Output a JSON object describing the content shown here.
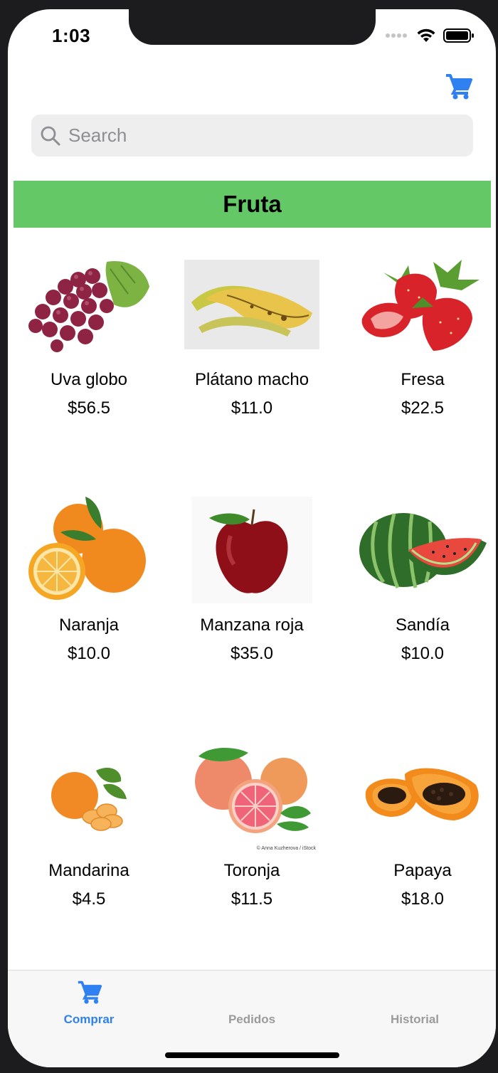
{
  "status_bar": {
    "time": "1:03"
  },
  "header": {
    "cart_icon": "cart-icon"
  },
  "search": {
    "placeholder": "Search",
    "value": ""
  },
  "category": {
    "title": "Fruta",
    "color": "#64c866"
  },
  "products": [
    {
      "name": "Uva globo",
      "price": "$56.5",
      "image": "grapes"
    },
    {
      "name": "Plátano macho",
      "price": "$11.0",
      "image": "plantain"
    },
    {
      "name": "Fresa",
      "price": "$22.5",
      "image": "strawberry"
    },
    {
      "name": "Naranja",
      "price": "$10.0",
      "image": "orange"
    },
    {
      "name": "Manzana roja",
      "price": "$35.0",
      "image": "apple"
    },
    {
      "name": "Sandía",
      "price": "$10.0",
      "image": "watermelon"
    },
    {
      "name": "Mandarina",
      "price": "$4.5",
      "image": "mandarin"
    },
    {
      "name": "Toronja",
      "price": "$11.5",
      "image": "grapefruit",
      "credit": "© Anna Kuzherova / iStock"
    },
    {
      "name": "Papaya",
      "price": "$18.0",
      "image": "papaya"
    }
  ],
  "tabs": [
    {
      "label": "Comprar",
      "icon": "cart-icon",
      "active": true
    },
    {
      "label": "Pedidos",
      "active": false
    },
    {
      "label": "Historial",
      "active": false
    }
  ],
  "colors": {
    "accent": "#2f80f0",
    "inactive_tab": "#9b9b9b"
  }
}
